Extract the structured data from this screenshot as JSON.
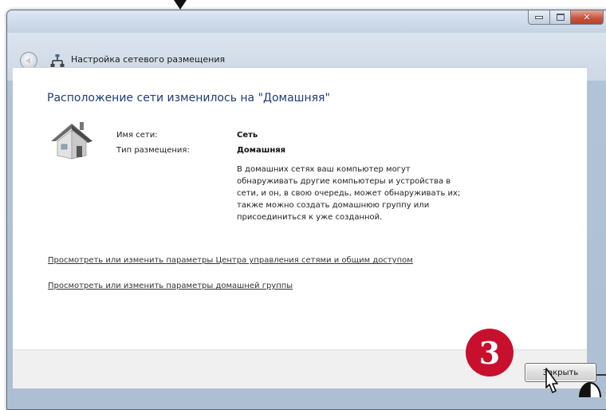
{
  "window": {
    "nav_title": "Настройка сетевого размещения",
    "caption_buttons": [
      "minimize",
      "maximize",
      "close"
    ]
  },
  "main": {
    "headline": "Расположение сети изменилось на \"Домашняя\"",
    "network_name_label": "Имя сети:",
    "network_name_value": "Сеть",
    "location_type_label": "Тип размещения:",
    "location_type_value": "Домашняя",
    "description_lines": [
      "В домашних сетях ваш компьютер могут",
      "обнаруживать другие компьютеры и устройства в",
      "сети, и он, в свою очередь, может обнаруживать их;",
      "также можно создать домашнюю группу или",
      "присоединиться к уже созданной."
    ],
    "link_network_center": "Просмотреть или изменить параметры Центра управления сетями и общим доступом",
    "link_homegroup": "Просмотреть или изменить параметры домашней группы"
  },
  "footer": {
    "close_label": "Закрыть"
  },
  "annotation": {
    "step_number": "3",
    "badge_color": "#c8102e"
  },
  "icons": {
    "back": "back-arrow-icon",
    "network": "network-icon",
    "house": "home-network-icon",
    "cursor": "mouse-pointer-icon",
    "mouse": "mouse-click-icon"
  }
}
